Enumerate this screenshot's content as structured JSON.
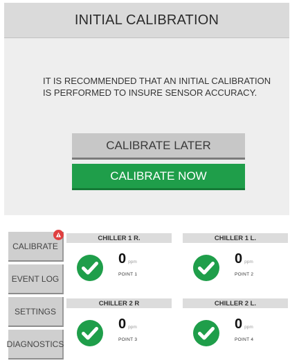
{
  "dialog": {
    "title": "INITIAL CALIBRATION",
    "message_line1": "IT IS RECOMMENDED THAT AN INITIAL CALIBRATION",
    "message_line2": "IS PERFORMED TO INSURE SENSOR ACCURACY.",
    "later_label": "CALIBRATE LATER",
    "now_label": "CALIBRATE NOW"
  },
  "sidebar": {
    "items": [
      {
        "label": "CALIBRATE",
        "has_alert": true
      },
      {
        "label": "EVENT LOG"
      },
      {
        "label": "SETTINGS"
      },
      {
        "label": "DIAGNOSTICS"
      }
    ]
  },
  "sensors": [
    {
      "name": "CHILLER 1 R.",
      "value": "0",
      "unit": "ppm",
      "point": "POINT 1",
      "status": "check-icon"
    },
    {
      "name": "CHILLER 1 L.",
      "value": "0",
      "unit": "ppm",
      "point": "POINT 2",
      "status": "check-icon"
    },
    {
      "name": "CHILLER 2 R",
      "value": "0",
      "unit": "ppm",
      "point": "POINT 3",
      "status": "check-icon"
    },
    {
      "name": "CHILLER 2 L.",
      "value": "0",
      "unit": "ppm",
      "point": "POINT 4",
      "status": "check-icon"
    }
  ],
  "colors": {
    "ok_green": "#1f9e4a",
    "alert_red": "#e04040",
    "button_gray": "#c7c7c7"
  }
}
